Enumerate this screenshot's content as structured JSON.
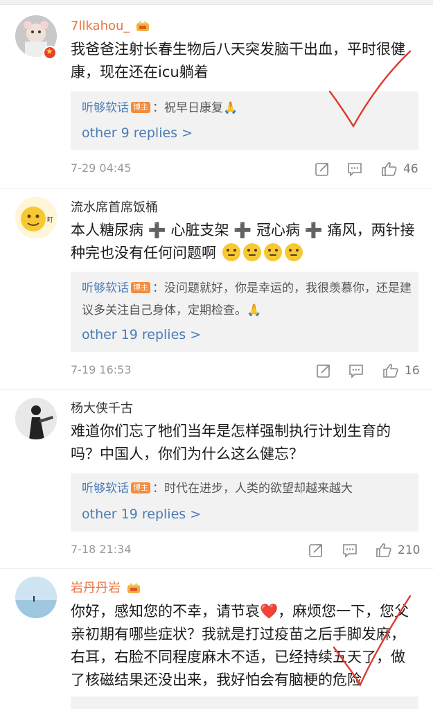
{
  "comments": [
    {
      "username": "7llkahou_",
      "text": "我爸爸注射长春生物后八天突发脑干出血，平时很健康，现在还在icu躺着",
      "reply_author": "听够软话",
      "reply_badge": "博主",
      "reply_text": "：祝早日康复🙏",
      "more_replies": "other 9 replies >",
      "time": "7-29 04:45",
      "likes": "46"
    },
    {
      "username": "流水席首席饭桶",
      "text_parts": [
        "本人糖尿病",
        "➕",
        " 心脏支架",
        "➕",
        " 冠心病",
        "➕",
        " 痛风，两针接种完也没有任何问题啊"
      ],
      "reply_author": "听够软话",
      "reply_badge": "博主",
      "reply_text": "：没问题就好，你是幸运的，我很羡慕你，还是建议多关注自己身体，定期检查。🙏",
      "more_replies": "other 19 replies >",
      "time": "7-19 16:53",
      "likes": "16"
    },
    {
      "username": "杨大侠千古",
      "text": "难道你们忘了牠们当年是怎样强制执行计划生育的吗？中国人，你们为什么这么健忘？",
      "reply_author": "听够软话",
      "reply_badge": "博主",
      "reply_text": "：时代在进步，人类的欲望却越来越大",
      "more_replies": "other 19 replies >",
      "time": "7-18 21:34",
      "likes": "210"
    },
    {
      "username": "岩丹丹岩",
      "text_before_heart": "你好，感知您的不幸，请节哀",
      "heart": "❤️",
      "text_after_heart": "，麻烦您一下，您父亲初期有哪些症状？我就是打过疫苗之后手脚发麻，右耳，右脸不同程度麻木不适，已经持续五天了，做了核磁结果还没出来，我好怕会有脑梗的危险"
    }
  ],
  "icons": {
    "share": "share-icon",
    "comment": "comment-icon",
    "like": "thumbs-up-icon",
    "crown": "crown-badge-icon"
  },
  "colors": {
    "username_vip": "#eb7340",
    "link_blue": "#4a7cb8",
    "badge_orange": "#f28b3c",
    "annotation_red": "#e0392c"
  }
}
